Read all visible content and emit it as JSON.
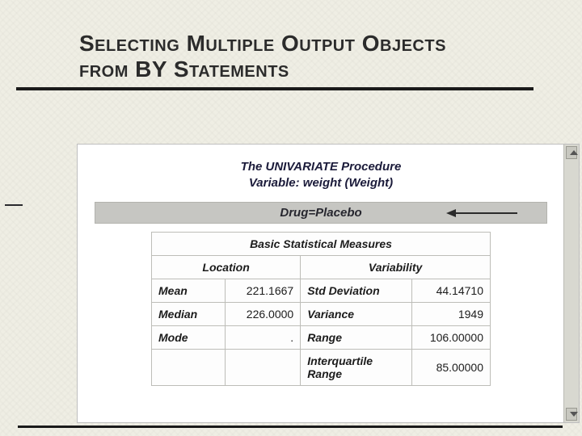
{
  "slide": {
    "title_line1": "Selecting Multiple Output Objects",
    "title_line2": "from BY Statements"
  },
  "output": {
    "proc_title": "The UNIVARIATE Procedure",
    "variable_line": "Variable: weight (Weight)",
    "by_line": "Drug=Placebo",
    "table_title": "Basic Statistical Measures",
    "location_hdr": "Location",
    "variability_hdr": "Variability",
    "rows": [
      {
        "loc_label": "Mean",
        "loc_value": "221.1667",
        "var_label": "Std Deviation",
        "var_value": "44.14710"
      },
      {
        "loc_label": "Median",
        "loc_value": "226.0000",
        "var_label": "Variance",
        "var_value": "1949"
      },
      {
        "loc_label": "Mode",
        "loc_value": ".",
        "var_label": "Range",
        "var_value": "106.00000"
      },
      {
        "loc_label": "",
        "loc_value": "",
        "var_label": "Interquartile Range",
        "var_value": "85.00000"
      }
    ]
  }
}
